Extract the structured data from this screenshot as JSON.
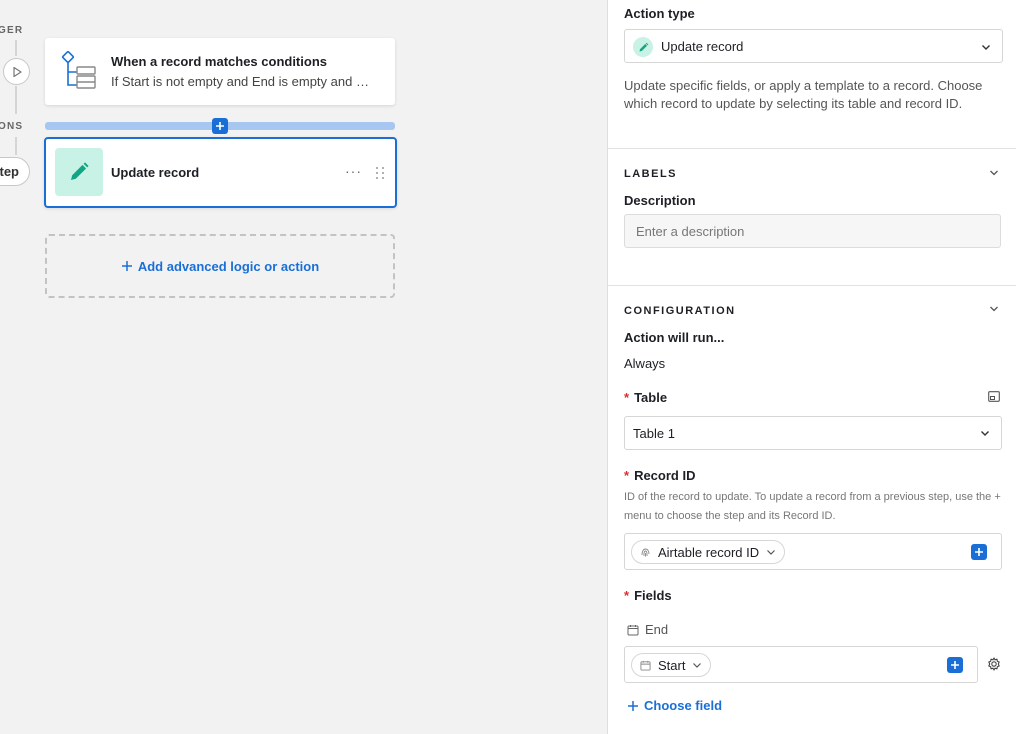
{
  "canvas": {
    "rail": {
      "trigger_label": "GER",
      "actions_label": "ONS",
      "step_label": "tep"
    },
    "trigger_card": {
      "title": "When a record matches conditions",
      "subtitle": "If Start is not empty and End is empty and …"
    },
    "action_card": {
      "title": "Update record",
      "more": "···"
    },
    "add_logic": {
      "label": "Add advanced logic or action"
    }
  },
  "panel": {
    "action_type": {
      "label": "Action type",
      "value": "Update record",
      "description": "Update specific fields, or apply a template to a record. Choose which record to update by selecting its table and record ID."
    },
    "labels": {
      "heading": "LABELS",
      "description_label": "Description",
      "description_placeholder": "Enter a description"
    },
    "configuration": {
      "heading": "CONFIGURATION",
      "run_label": "Action will run...",
      "run_value": "Always",
      "table_label": "Table",
      "table_value": "Table 1",
      "record_id_label": "Record ID",
      "record_id_help": "ID of the record to update. To update a record from a previous step, use the + menu to choose the step and its Record ID.",
      "record_id_token": "Airtable record ID",
      "fields_label": "Fields",
      "field_end": "End",
      "field_start_token": "Start",
      "choose_field": "Choose field",
      "required_marker": "*"
    }
  },
  "colors": {
    "accent": "#1a6fd6",
    "action_icon_bg": "#c7f2e5",
    "action_icon_fg": "#11a683",
    "required": "#d92e2e"
  },
  "icons": {
    "trigger": "conditions-tree-icon",
    "action": "pencil-icon",
    "table": "table-expand-icon",
    "record_id": "fingerprint-icon",
    "field_date": "calendar-icon",
    "settings": "gear-icon"
  }
}
